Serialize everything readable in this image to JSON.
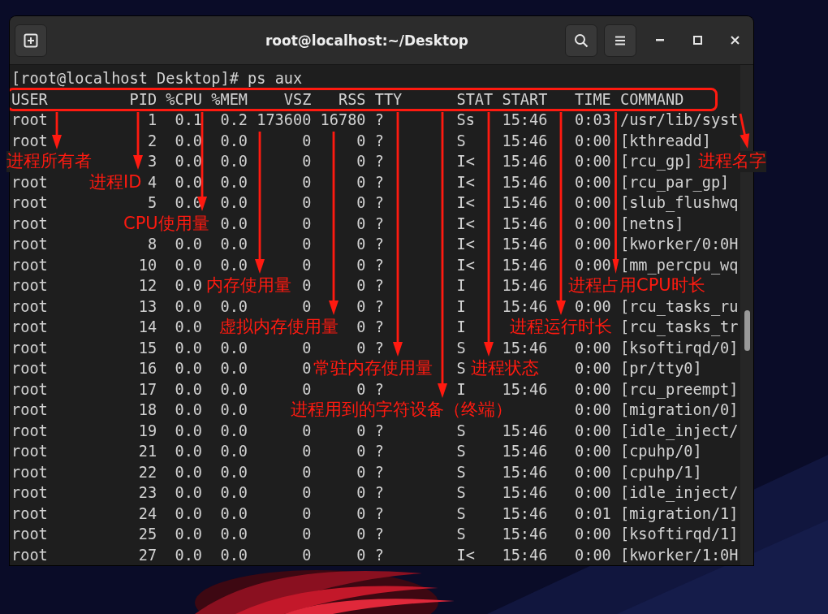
{
  "window": {
    "title": "root@localhost:~/Desktop"
  },
  "terminal": {
    "prompt": "[root@localhost Desktop]# ps aux",
    "header_highlighted": true,
    "columns": [
      "USER",
      "PID",
      "%CPU",
      "%MEM",
      "VSZ",
      "RSS",
      "TTY",
      "STAT",
      "START",
      "TIME",
      "COMMAND"
    ],
    "rows": [
      {
        "user": "root",
        "pid": "1",
        "cpu": "0.1",
        "mem": "0.2",
        "vsz": "173600",
        "rss": "16780",
        "tty": "?",
        "stat": "Ss",
        "start": "15:46",
        "time": "0:03",
        "command": "/usr/lib/syst"
      },
      {
        "user": "root",
        "pid": "2",
        "cpu": "0.0",
        "mem": "0.0",
        "vsz": "0",
        "rss": "0",
        "tty": "?",
        "stat": "S",
        "start": "15:46",
        "time": "0:00",
        "command": "[kthreadd]"
      },
      {
        "pid": "3",
        "cpu": "0.0",
        "mem": "0.0",
        "vsz": "0",
        "rss": "0",
        "tty": "?",
        "stat": "I<",
        "start": "15:46",
        "time": "0:00",
        "command": "[rcu_gp]"
      },
      {
        "user": "root",
        "pid": "4",
        "cpu": "0.0",
        "mem": "0.0",
        "vsz": "0",
        "rss": "0",
        "tty": "?",
        "stat": "I<",
        "start": "15:46",
        "time": "0:00",
        "command": "[rcu_par_gp]"
      },
      {
        "user": "root",
        "pid": "5",
        "cpu": "0.0",
        "mem": "0.0",
        "vsz": "0",
        "rss": "0",
        "tty": "?",
        "stat": "I<",
        "start": "15:46",
        "time": "0:00",
        "command": "[slub_flushwq"
      },
      {
        "user": "root",
        "mem": "0.0",
        "vsz": "0",
        "rss": "0",
        "tty": "?",
        "stat": "I<",
        "start": "15:46",
        "time": "0:00",
        "command": "[netns]"
      },
      {
        "user": "root",
        "pid": "8",
        "cpu": "0.0",
        "mem": "0.0",
        "vsz": "0",
        "rss": "0",
        "tty": "?",
        "stat": "I<",
        "start": "15:46",
        "time": "0:00",
        "command": "[kworker/0:0H"
      },
      {
        "user": "root",
        "pid": "10",
        "cpu": "0.0",
        "mem": "0.0",
        "vsz": "0",
        "rss": "0",
        "tty": "?",
        "stat": "I<",
        "start": "15:46",
        "time": "0:00",
        "command": "[mm_percpu_wq"
      },
      {
        "user": "root",
        "pid": "12",
        "cpu": "0.0",
        "vsz": "0",
        "rss": "0",
        "tty": "?",
        "stat": "I",
        "start": "15:46"
      },
      {
        "user": "root",
        "pid": "13",
        "cpu": "0.0",
        "mem": "0.0",
        "vsz": "0",
        "rss": "0",
        "tty": "?",
        "stat": "I",
        "start": "15:46",
        "time": "0:00",
        "command": "[rcu_tasks_ru"
      },
      {
        "user": "root",
        "pid": "14",
        "cpu": "0.0",
        "rss": "0",
        "tty": "?",
        "stat": "I",
        "command": "[rcu_tasks_tr"
      },
      {
        "user": "root",
        "pid": "15",
        "cpu": "0.0",
        "mem": "0.0",
        "vsz": "0",
        "rss": "0",
        "tty": "?",
        "stat": "S",
        "start": "15:46",
        "time": "0:00",
        "command": "[ksoftirqd/0]"
      },
      {
        "user": "root",
        "pid": "16",
        "cpu": "0.0",
        "mem": "0.0",
        "vsz": "0",
        "stat": "S",
        "time": "0:00",
        "command": "[pr/tty0]"
      },
      {
        "user": "root",
        "pid": "17",
        "cpu": "0.0",
        "mem": "0.0",
        "vsz": "0",
        "rss": "0",
        "tty": "?",
        "stat": "I",
        "start": "15:46",
        "time": "0:00",
        "command": "[rcu_preempt]"
      },
      {
        "user": "root",
        "pid": "18",
        "cpu": "0.0",
        "mem": "0.0",
        "time": "0:00",
        "command": "[migration/0]"
      },
      {
        "user": "root",
        "pid": "19",
        "cpu": "0.0",
        "mem": "0.0",
        "vsz": "0",
        "rss": "0",
        "tty": "?",
        "stat": "S",
        "start": "15:46",
        "time": "0:00",
        "command": "[idle_inject/"
      },
      {
        "user": "root",
        "pid": "21",
        "cpu": "0.0",
        "mem": "0.0",
        "vsz": "0",
        "rss": "0",
        "tty": "?",
        "stat": "S",
        "start": "15:46",
        "time": "0:00",
        "command": "[cpuhp/0]"
      },
      {
        "user": "root",
        "pid": "22",
        "cpu": "0.0",
        "mem": "0.0",
        "vsz": "0",
        "rss": "0",
        "tty": "?",
        "stat": "S",
        "start": "15:46",
        "time": "0:00",
        "command": "[cpuhp/1]"
      },
      {
        "user": "root",
        "pid": "23",
        "cpu": "0.0",
        "mem": "0.0",
        "vsz": "0",
        "rss": "0",
        "tty": "?",
        "stat": "S",
        "start": "15:46",
        "time": "0:00",
        "command": "[idle_inject/"
      },
      {
        "user": "root",
        "pid": "24",
        "cpu": "0.0",
        "mem": "0.0",
        "vsz": "0",
        "rss": "0",
        "tty": "?",
        "stat": "S",
        "start": "15:46",
        "time": "0:01",
        "command": "[migration/1]"
      },
      {
        "user": "root",
        "pid": "25",
        "cpu": "0.0",
        "mem": "0.0",
        "vsz": "0",
        "rss": "0",
        "tty": "?",
        "stat": "S",
        "start": "15:46",
        "time": "0:00",
        "command": "[ksoftirqd/1]"
      },
      {
        "user": "root",
        "pid": "27",
        "cpu": "0.0",
        "mem": "0.0",
        "vsz": "0",
        "rss": "0",
        "tty": "?",
        "stat": "I<",
        "start": "15:46",
        "time": "0:00",
        "command": "[kworker/1:0H"
      }
    ]
  },
  "annotations": [
    {
      "text": "进程所有者"
    },
    {
      "text": "进程名字"
    },
    {
      "text": "进程ID"
    },
    {
      "text": "CPU使用量"
    },
    {
      "text": "内存使用量"
    },
    {
      "text": "进程占用CPU时长"
    },
    {
      "text": "虚拟内存使用量"
    },
    {
      "text": "进程运行时长"
    },
    {
      "text": "常驻内存使用量"
    },
    {
      "text": "进程状态"
    },
    {
      "text": "进程用到的字符设备（终端）"
    }
  ]
}
